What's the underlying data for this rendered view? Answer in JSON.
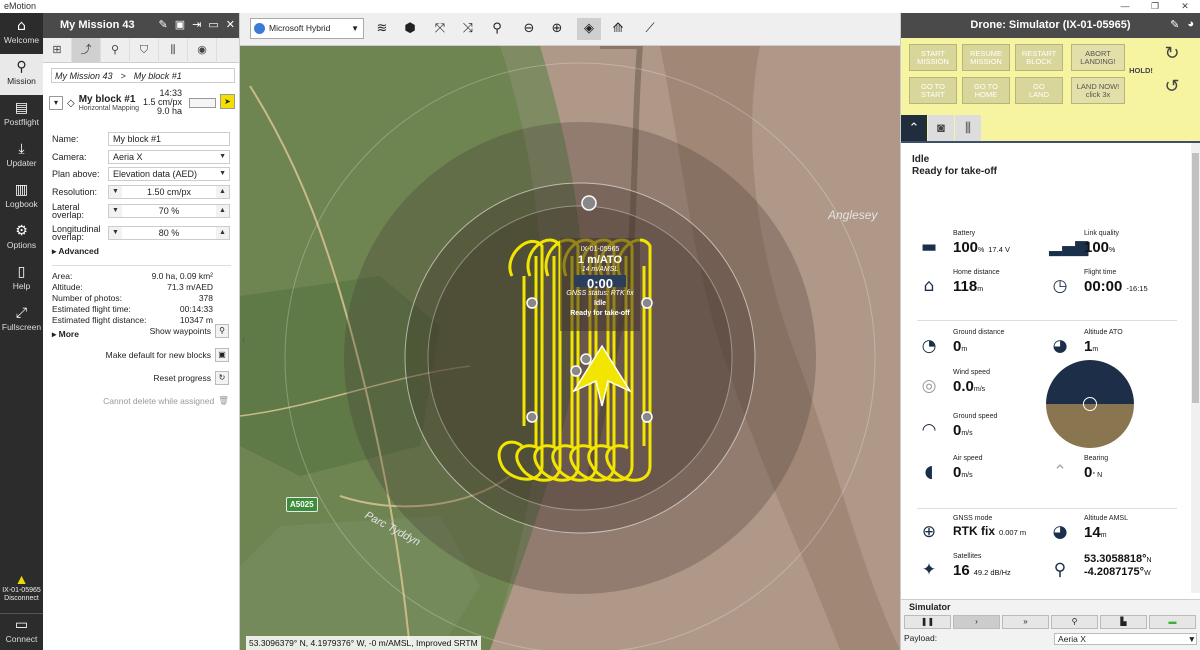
{
  "app": {
    "title": "eMotion",
    "win": [
      "—",
      "❐",
      "✕"
    ]
  },
  "nav": {
    "items": [
      {
        "label": "Welcome",
        "icon": "home-icon"
      },
      {
        "label": "Mission",
        "icon": "route-icon"
      },
      {
        "label": "Postflight",
        "icon": "layers-icon"
      },
      {
        "label": "Updater",
        "icon": "download-icon"
      },
      {
        "label": "Logbook",
        "icon": "book-icon"
      },
      {
        "label": "Options",
        "icon": "gear-icon"
      },
      {
        "label": "Help",
        "icon": "help-book-icon"
      },
      {
        "label": "Fullscreen",
        "icon": "fullscreen-icon"
      }
    ],
    "drone_id": "IX-01-05965",
    "drone_action": "Disconnect",
    "connect": "Connect"
  },
  "mission": {
    "title": "My Mission 43",
    "breadcrumb": [
      "My Mission 43",
      ">",
      "My block #1"
    ],
    "block": {
      "name": "My block #1",
      "type": "Horizontal Mapping",
      "time": "14:33",
      "resolution": "1.5 cm/px",
      "area": "9.0 ha"
    },
    "form": {
      "name_label": "Name:",
      "name_value": "My block #1",
      "camera_label": "Camera:",
      "camera_value": "Aeria X",
      "plan_label": "Plan above:",
      "plan_value": "Elevation data (AED)",
      "res_label": "Resolution:",
      "res_value": "1.50 cm/px",
      "lat_label": "Lateral overlap:",
      "lat_value": "70 %",
      "long_label": "Longitudinal overlap:",
      "long_value": "80 %",
      "advanced": "Advanced"
    },
    "stats": [
      {
        "k": "Area:",
        "v": "9.0 ha, 0.09 km²"
      },
      {
        "k": "Altitude:",
        "v": "71.3 m/AED"
      },
      {
        "k": "Number of photos:",
        "v": "378"
      },
      {
        "k": "Estimated flight time:",
        "v": "00:14:33"
      },
      {
        "k": "Estimated flight distance:",
        "v": "10347 m"
      }
    ],
    "more": "More",
    "actions": {
      "show_waypoints": "Show waypoints",
      "make_default": "Make default for new blocks",
      "reset_progress": "Reset progress",
      "cannot_delete": "Cannot delete while assigned"
    }
  },
  "map": {
    "layer": "Microsoft Hybrid",
    "place": "Anglesey",
    "road": "A5025",
    "place2": "Parc Tyddyn",
    "coords": "53.3096379° N, 4.1979376° W, -0 m/AMSL, Improved SRTM",
    "drone": {
      "id": "IX-01-05965",
      "alt": "1 m/ATO",
      "amsl": "14 m/AMSL",
      "timer": "0:00",
      "gnss": "GNSS status: RTK fix",
      "state1": "Idle",
      "state2": "Ready for take-off"
    }
  },
  "drone": {
    "title": "Drone: Simulator (IX-01-05965)",
    "buttons": [
      {
        "l1": "START",
        "l2": "MISSION"
      },
      {
        "l1": "RESUME",
        "l2": "MISSION"
      },
      {
        "l1": "RESTART",
        "l2": "BLOCK"
      },
      {
        "l1": "ABORT",
        "l2": "LANDING!"
      },
      {
        "l1": "GO TO",
        "l2": "START"
      },
      {
        "l1": "GO TO",
        "l2": "HOME"
      },
      {
        "l1": "GO",
        "l2": "LAND"
      },
      {
        "l1": "LAND NOW!",
        "l2": "click 3x"
      }
    ],
    "hold": "HOLD!",
    "status1": "Idle",
    "status2": "Ready for take-off",
    "telemetry": {
      "battery": {
        "label": "Battery",
        "value": "100",
        "unit": "%",
        "extra": "17.4 V"
      },
      "link": {
        "label": "Link quality",
        "value": "100",
        "unit": "%"
      },
      "home": {
        "label": "Home distance",
        "value": "118",
        "unit": "m"
      },
      "flight": {
        "label": "Flight time",
        "value": "00:00",
        "extra": "-16:15"
      },
      "ground_dist": {
        "label": "Ground distance",
        "value": "0",
        "unit": "m"
      },
      "alt_ato": {
        "label": "Altitude ATO",
        "value": "1",
        "unit": "m"
      },
      "wind": {
        "label": "Wind speed",
        "value": "0.0",
        "unit": "m/s"
      },
      "gspeed": {
        "label": "Ground speed",
        "value": "0",
        "unit": "m/s"
      },
      "aspeed": {
        "label": "Air speed",
        "value": "0",
        "unit": "m/s"
      },
      "bearing": {
        "label": "Bearing",
        "value": "0",
        "unit": "° N"
      },
      "gnss": {
        "label": "GNSS mode",
        "value": "RTK fix",
        "extra": "0.007 m"
      },
      "alt_amsl": {
        "label": "Altitude AMSL",
        "value": "14",
        "unit": "m"
      },
      "sats": {
        "label": "Satellites",
        "value": "16",
        "extra": "49.2 dB/Hz"
      },
      "lat": {
        "value": "53.3058818°",
        "unit": "N"
      },
      "lon": {
        "value": "-4.2087175°",
        "unit": "W"
      }
    },
    "sim": {
      "title": "Simulator",
      "payload_label": "Payload:",
      "payload_value": "Aeria X"
    }
  },
  "colors": {
    "yellow_panel": "#f6f4a0",
    "flight_path": "#f2e500",
    "dark_header": "#4a4a4a"
  }
}
